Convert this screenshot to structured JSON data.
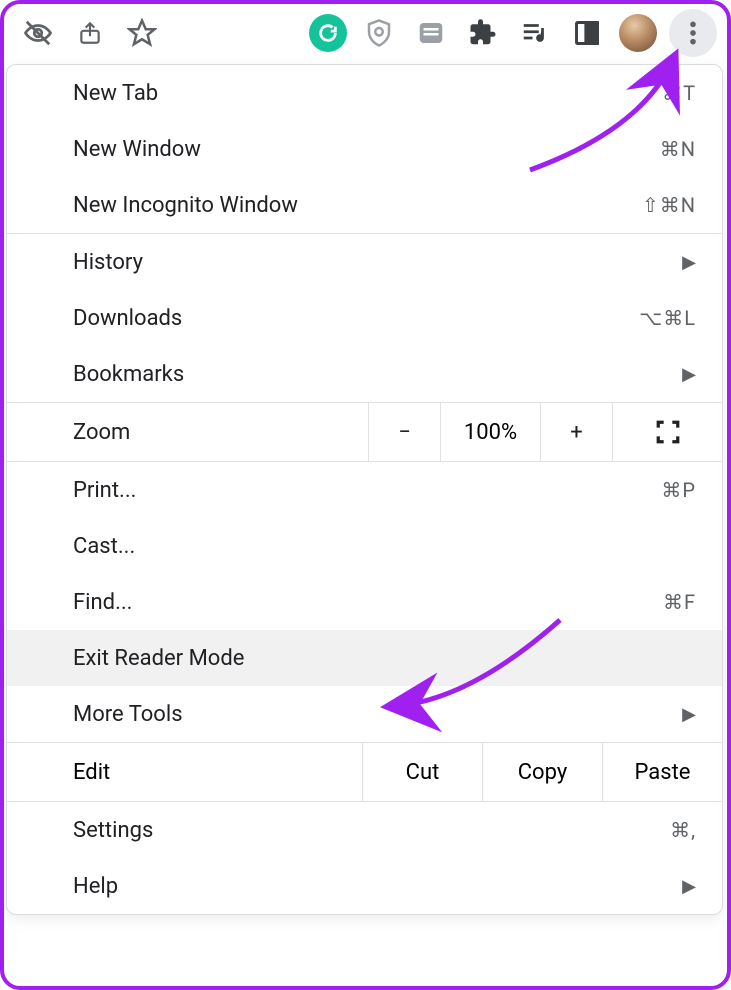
{
  "toolbar": {
    "icons": [
      "incognito-off",
      "share",
      "star",
      "grammarly",
      "shield",
      "reader",
      "extensions",
      "music-queue",
      "device"
    ],
    "profile": "avatar",
    "menu_button": "more"
  },
  "menu": {
    "group1": [
      {
        "label": "New Tab",
        "shortcut": "⌘T"
      },
      {
        "label": "New Window",
        "shortcut": "⌘N"
      },
      {
        "label": "New Incognito Window",
        "shortcut": "⇧⌘N"
      }
    ],
    "group2": [
      {
        "label": "History",
        "submenu": true
      },
      {
        "label": "Downloads",
        "shortcut": "⌥⌘L"
      },
      {
        "label": "Bookmarks",
        "submenu": true
      }
    ],
    "zoom": {
      "label": "Zoom",
      "minus": "−",
      "percent": "100%",
      "plus": "+"
    },
    "group3": [
      {
        "label": "Print...",
        "shortcut": "⌘P"
      },
      {
        "label": "Cast..."
      },
      {
        "label": "Find...",
        "shortcut": "⌘F"
      },
      {
        "label": "Exit Reader Mode",
        "highlight": true
      },
      {
        "label": "More Tools",
        "submenu": true
      }
    ],
    "edit": {
      "label": "Edit",
      "cut": "Cut",
      "copy": "Copy",
      "paste": "Paste"
    },
    "group4": [
      {
        "label": "Settings",
        "shortcut": "⌘,"
      },
      {
        "label": "Help",
        "submenu": true
      }
    ]
  }
}
